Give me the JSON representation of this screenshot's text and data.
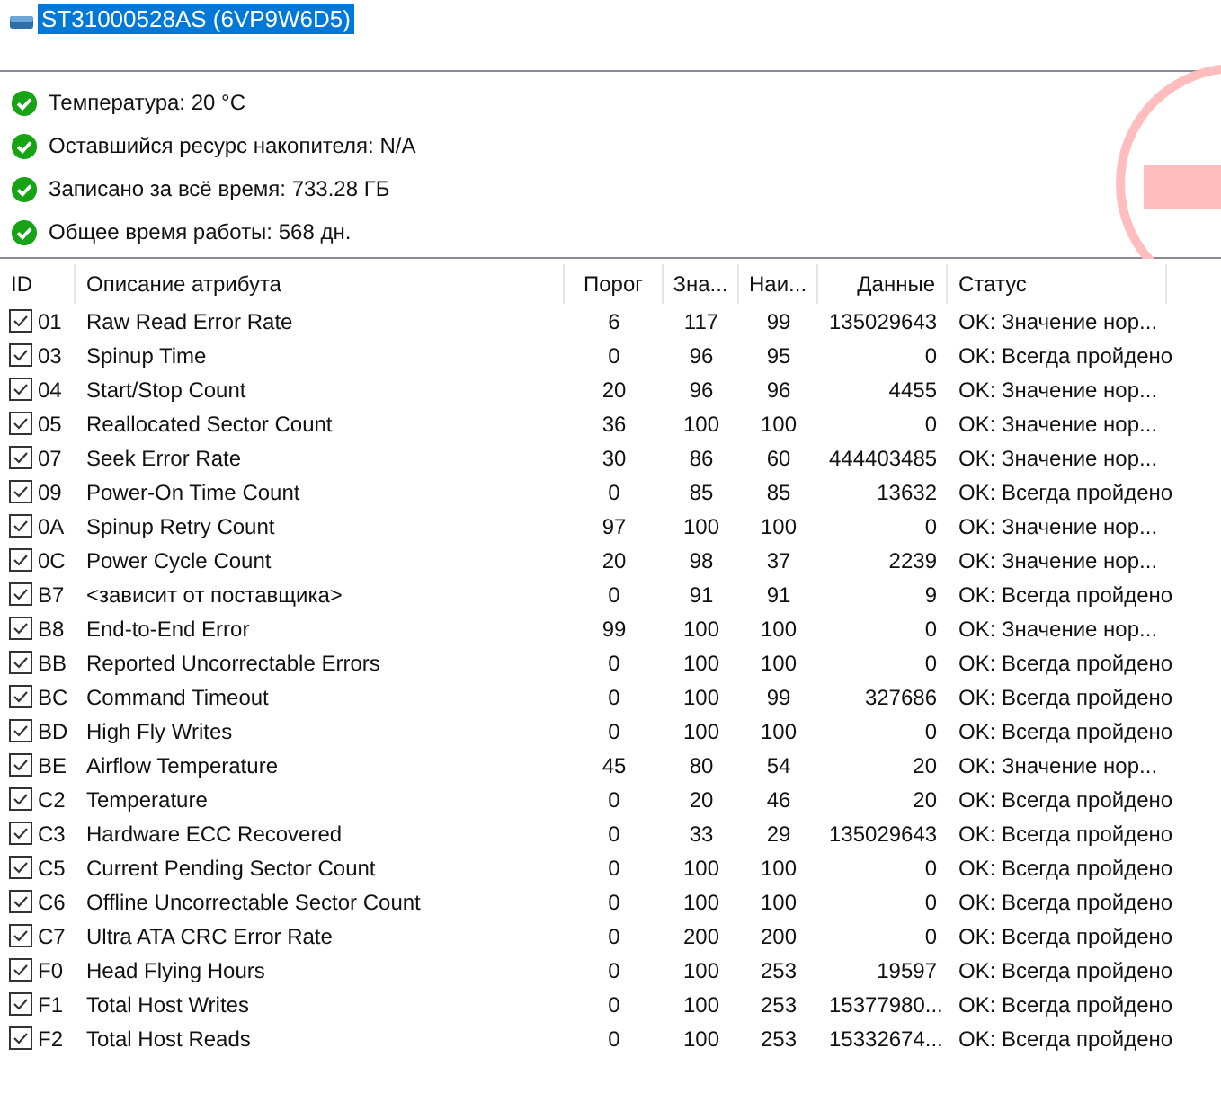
{
  "drive": {
    "title": "ST31000528AS (6VP9W6D5)",
    "selected": true
  },
  "summary": [
    {
      "text": "Температура: 20 °C",
      "ok": true
    },
    {
      "text": "Оставшийся ресурс накопителя: N/A",
      "ok": true
    },
    {
      "text": "Записано за всё время: 733.28 ГБ",
      "ok": true
    },
    {
      "text": "Общее время работы: 568 дн.",
      "ok": true
    }
  ],
  "table": {
    "columns": [
      "ID",
      "Описание атрибута",
      "Порог",
      "Зна...",
      "Наи...",
      "Данные",
      "Статус"
    ],
    "rows": [
      {
        "checked": true,
        "cells": [
          "01",
          "Raw Read Error Rate",
          "6",
          "117",
          "99",
          "135029643",
          "OK: Значение нор..."
        ]
      },
      {
        "checked": true,
        "cells": [
          "03",
          "Spinup Time",
          "0",
          "96",
          "95",
          "0",
          "OK: Всегда пройдено"
        ]
      },
      {
        "checked": true,
        "cells": [
          "04",
          "Start/Stop Count",
          "20",
          "96",
          "96",
          "4455",
          "OK: Значение нор..."
        ]
      },
      {
        "checked": true,
        "cells": [
          "05",
          "Reallocated Sector Count",
          "36",
          "100",
          "100",
          "0",
          "OK: Значение нор..."
        ]
      },
      {
        "checked": true,
        "cells": [
          "07",
          "Seek Error Rate",
          "30",
          "86",
          "60",
          "444403485",
          "OK: Значение нор..."
        ]
      },
      {
        "checked": true,
        "cells": [
          "09",
          "Power-On Time Count",
          "0",
          "85",
          "85",
          "13632",
          "OK: Всегда пройдено"
        ]
      },
      {
        "checked": true,
        "cells": [
          "0A",
          "Spinup Retry Count",
          "97",
          "100",
          "100",
          "0",
          "OK: Значение нор..."
        ]
      },
      {
        "checked": true,
        "cells": [
          "0C",
          "Power Cycle Count",
          "20",
          "98",
          "37",
          "2239",
          "OK: Значение нор..."
        ]
      },
      {
        "checked": true,
        "cells": [
          "B7",
          "<зависит от поставщика>",
          "0",
          "91",
          "91",
          "9",
          "OK: Всегда пройдено"
        ]
      },
      {
        "checked": true,
        "cells": [
          "B8",
          "End-to-End Error",
          "99",
          "100",
          "100",
          "0",
          "OK: Значение нор..."
        ]
      },
      {
        "checked": true,
        "cells": [
          "BB",
          "Reported Uncorrectable Errors",
          "0",
          "100",
          "100",
          "0",
          "OK: Всегда пройдено"
        ]
      },
      {
        "checked": true,
        "cells": [
          "BC",
          "Command Timeout",
          "0",
          "100",
          "99",
          "327686",
          "OK: Всегда пройдено"
        ]
      },
      {
        "checked": true,
        "cells": [
          "BD",
          "High Fly Writes",
          "0",
          "100",
          "100",
          "0",
          "OK: Всегда пройдено"
        ]
      },
      {
        "checked": true,
        "cells": [
          "BE",
          "Airflow Temperature",
          "45",
          "80",
          "54",
          "20",
          "OK: Значение нор..."
        ]
      },
      {
        "checked": true,
        "cells": [
          "C2",
          "Temperature",
          "0",
          "20",
          "46",
          "20",
          "OK: Всегда пройдено"
        ]
      },
      {
        "checked": true,
        "cells": [
          "C3",
          "Hardware ECC Recovered",
          "0",
          "33",
          "29",
          "135029643",
          "OK: Всегда пройдено"
        ]
      },
      {
        "checked": true,
        "cells": [
          "C5",
          "Current Pending Sector Count",
          "0",
          "100",
          "100",
          "0",
          "OK: Всегда пройдено"
        ]
      },
      {
        "checked": true,
        "cells": [
          "C6",
          "Offline Uncorrectable Sector Count",
          "0",
          "100",
          "100",
          "0",
          "OK: Всегда пройдено"
        ]
      },
      {
        "checked": true,
        "cells": [
          "C7",
          "Ultra ATA CRC Error Rate",
          "0",
          "200",
          "200",
          "0",
          "OK: Всегда пройдено"
        ]
      },
      {
        "checked": true,
        "cells": [
          "F0",
          "Head Flying Hours",
          "0",
          "100",
          "253",
          "19597",
          "OK: Всегда пройдено"
        ]
      },
      {
        "checked": true,
        "cells": [
          "F1",
          "Total Host Writes",
          "0",
          "100",
          "253",
          "15377980...",
          "OK: Всегда пройдено"
        ]
      },
      {
        "checked": true,
        "cells": [
          "F2",
          "Total Host Reads",
          "0",
          "100",
          "253",
          "15332674...",
          "OK: Всегда пройдено"
        ]
      }
    ]
  }
}
